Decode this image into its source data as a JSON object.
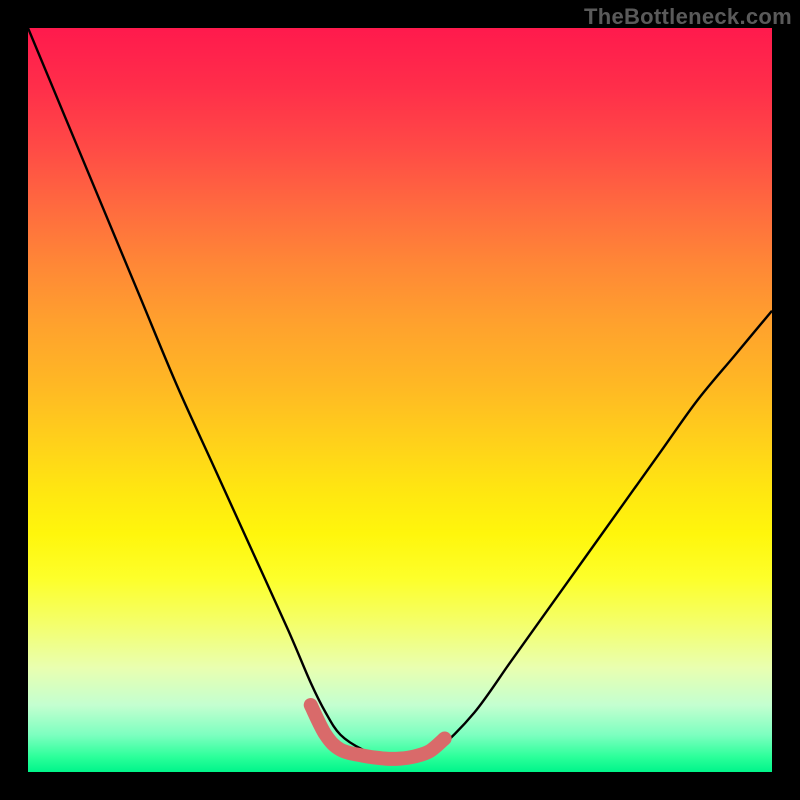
{
  "watermark": "TheBottleneck.com",
  "chart_data": {
    "type": "line",
    "title": "",
    "xlabel": "",
    "ylabel": "",
    "xlim": [
      0,
      100
    ],
    "ylim": [
      0,
      100
    ],
    "series": [
      {
        "name": "curve",
        "x": [
          0,
          5,
          10,
          15,
          20,
          25,
          30,
          35,
          38,
          40,
          42,
          45,
          48,
          50,
          52,
          55,
          60,
          65,
          70,
          75,
          80,
          85,
          90,
          95,
          100
        ],
        "y": [
          100,
          88,
          76,
          64,
          52,
          41,
          30,
          19,
          12,
          8,
          5,
          3,
          2,
          2,
          2,
          3,
          8,
          15,
          22,
          29,
          36,
          43,
          50,
          56,
          62
        ]
      },
      {
        "name": "highlight",
        "x": [
          38,
          40,
          42,
          45,
          48,
          50,
          52,
          54,
          56
        ],
        "y": [
          9,
          5,
          3,
          2.2,
          1.8,
          1.8,
          2.1,
          2.8,
          4.5
        ]
      }
    ],
    "grid": false,
    "legend": false,
    "background_gradient": [
      "#ff1a4d",
      "#ffd21a",
      "#fdff2a",
      "#00f58a"
    ]
  }
}
